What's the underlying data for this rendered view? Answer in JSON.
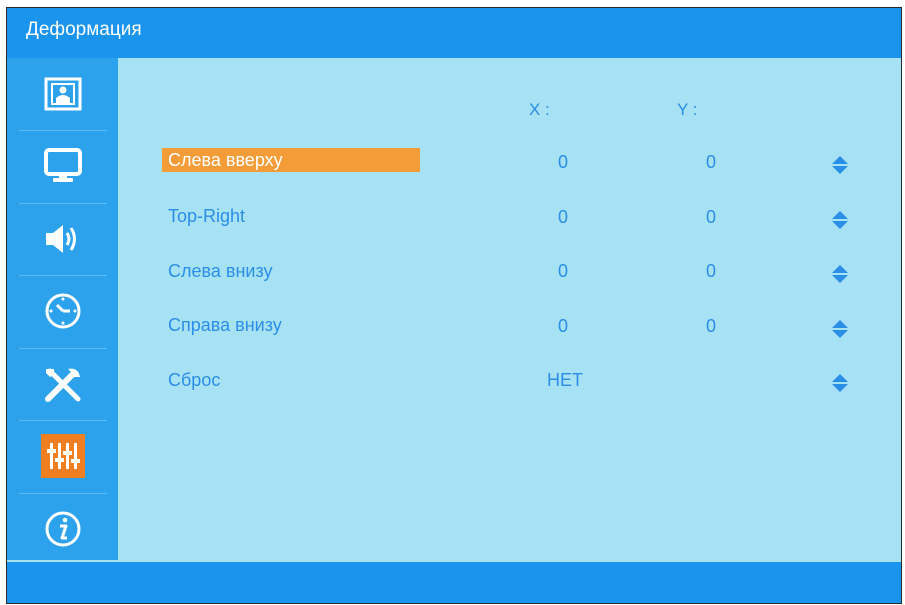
{
  "window": {
    "title": "Деформация"
  },
  "sidebar": {
    "items": [
      {
        "icon": "picture-icon",
        "active": false
      },
      {
        "icon": "monitor-icon",
        "active": false
      },
      {
        "icon": "speaker-icon",
        "active": false
      },
      {
        "icon": "clock-icon",
        "active": false
      },
      {
        "icon": "tools-icon",
        "active": false
      },
      {
        "icon": "equalizer-icon",
        "active": true
      },
      {
        "icon": "info-icon",
        "active": false
      }
    ]
  },
  "columns": {
    "x": "X :",
    "y": "Y :"
  },
  "rows": [
    {
      "label": "Слева вверху",
      "x": "0",
      "y": "0",
      "selected": true
    },
    {
      "label": "Top-Right",
      "x": "0",
      "y": "0",
      "selected": false
    },
    {
      "label": "Слева внизу",
      "x": "0",
      "y": "0",
      "selected": false
    },
    {
      "label": "Справа внизу",
      "x": "0",
      "y": "0",
      "selected": false
    },
    {
      "label": "Сброс",
      "x": "НЕТ",
      "y": "",
      "selected": false
    }
  ],
  "colors": {
    "title_bar": "#1a94ec",
    "sidebar": "#2ca1ec",
    "panel": "#a6e1f4",
    "text": "#2a8ee6",
    "highlight": "#f49c38",
    "active_icon": "#f07f22"
  }
}
